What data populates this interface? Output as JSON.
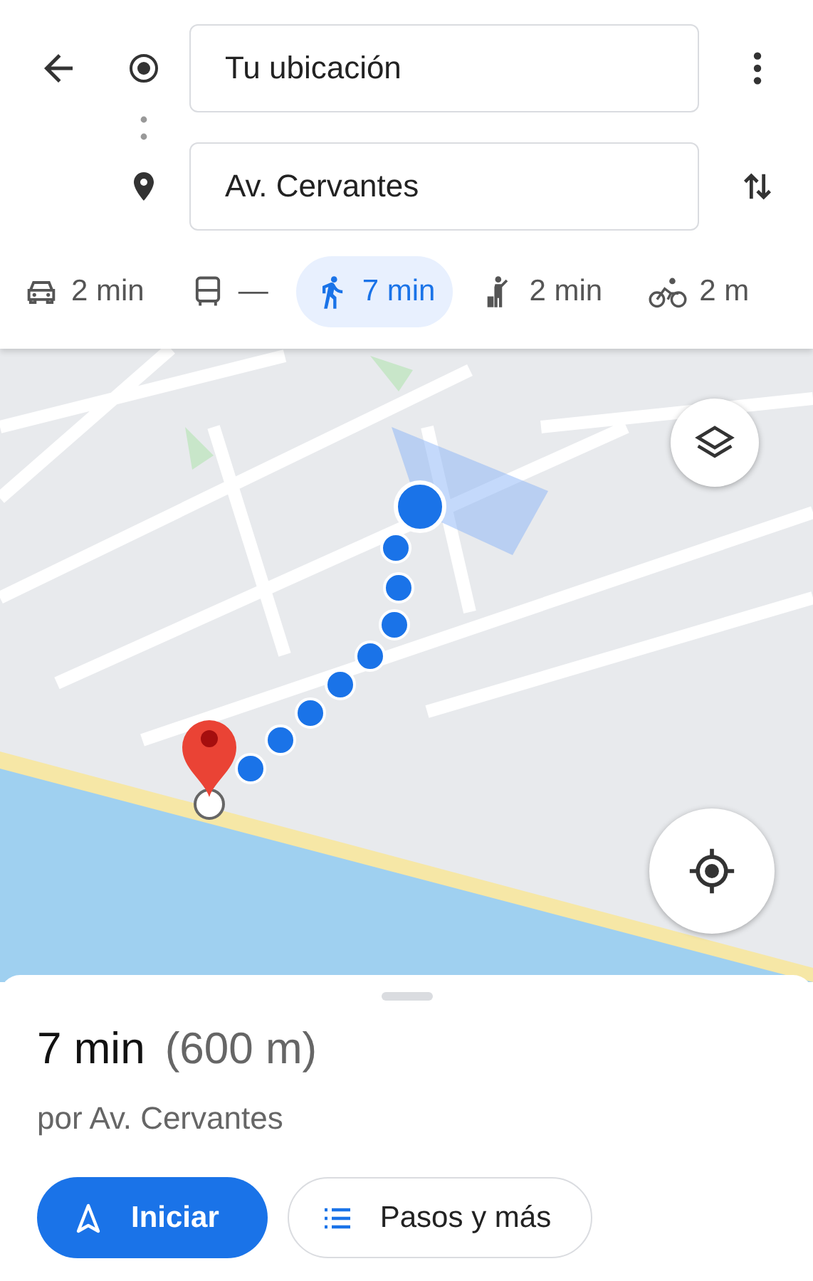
{
  "origin": {
    "value": "Tu ubicación"
  },
  "destination": {
    "value": "Av. Cervantes"
  },
  "modes": [
    {
      "kind": "car",
      "label": "2 min",
      "selected": false
    },
    {
      "kind": "bus",
      "label": "—",
      "selected": false
    },
    {
      "kind": "walk",
      "label": "7 min",
      "selected": true
    },
    {
      "kind": "ride",
      "label": "2 min",
      "selected": false
    },
    {
      "kind": "bike",
      "label": "2 m",
      "selected": false
    }
  ],
  "route": {
    "duration": "7 min",
    "distance": "(600 m)",
    "via": "por Av. Cervantes"
  },
  "buttons": [
    {
      "kind": "start",
      "label": "Iniciar"
    },
    {
      "kind": "steps",
      "label": "Pasos y más"
    }
  ]
}
